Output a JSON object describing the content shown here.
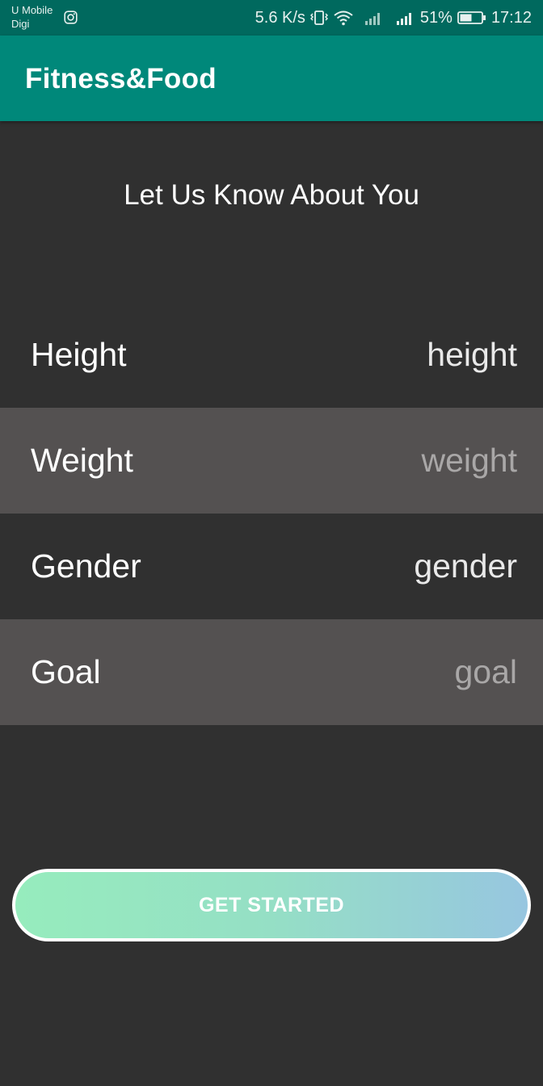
{
  "status_bar": {
    "carrier_1": "U Mobile",
    "carrier_2": "Digi",
    "network_speed": "5.6 K/s",
    "battery_percent": "51%",
    "time": "17:12",
    "icons": [
      "instagram-icon",
      "vibrate-icon",
      "wifi-icon",
      "signal-icon",
      "battery-icon"
    ]
  },
  "app_bar": {
    "title": "Fitness&Food",
    "color": "#00887a"
  },
  "page": {
    "heading": "Let Us Know About You"
  },
  "form": {
    "rows": [
      {
        "label": "Height",
        "placeholder": "height"
      },
      {
        "label": "Weight",
        "placeholder": "weight"
      },
      {
        "label": "Gender",
        "placeholder": "gender"
      },
      {
        "label": "Goal",
        "placeholder": "goal"
      }
    ]
  },
  "button": {
    "label": "GET STARTED",
    "gradient_start": "#96ecbd",
    "gradient_end": "#97c6e0"
  }
}
